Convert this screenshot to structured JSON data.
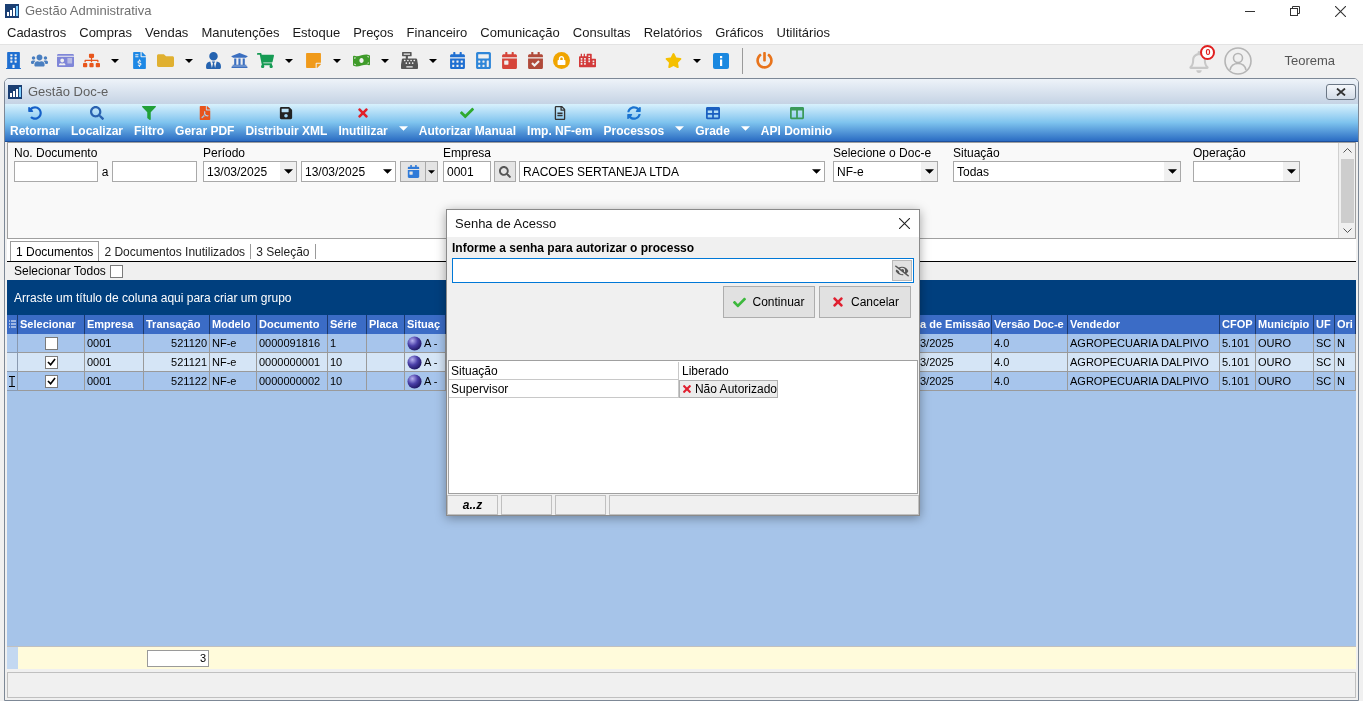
{
  "window": {
    "title": "Gestão Administrativa"
  },
  "menu": [
    "Cadastros",
    "Compras",
    "Vendas",
    "Manutenções",
    "Estoque",
    "Preços",
    "Financeiro",
    "Comunicação",
    "Consultas",
    "Relatórios",
    "Gráficos",
    "Utilitários"
  ],
  "toolbar": [
    {
      "kind": "button"
    },
    {
      "kind": "button"
    },
    {
      "kind": "button"
    },
    {
      "kind": "split"
    },
    {
      "kind": "button"
    },
    {
      "kind": "split"
    },
    {
      "kind": "button"
    },
    {
      "kind": "button"
    },
    {
      "kind": "split"
    },
    {
      "kind": "split"
    },
    {
      "kind": "split"
    },
    {
      "kind": "split"
    },
    {
      "kind": "button"
    },
    {
      "kind": "button"
    },
    {
      "kind": "button"
    },
    {
      "kind": "button"
    },
    {
      "kind": "button"
    },
    {
      "kind": "button"
    },
    {
      "kind": "split"
    },
    {
      "kind": "button"
    },
    {
      "kind": "separator"
    },
    {
      "kind": "button"
    }
  ],
  "notifications": {
    "count": "0"
  },
  "user": {
    "name": "Teorema"
  },
  "child_window": {
    "title": "Gestão Doc-e"
  },
  "ribbon": [
    {
      "label": "Retornar",
      "kind": "button"
    },
    {
      "label": "Localizar",
      "kind": "button"
    },
    {
      "label": "Filtro",
      "kind": "button"
    },
    {
      "label": "Gerar PDF",
      "kind": "button"
    },
    {
      "label": "Distribuir XML",
      "kind": "button"
    },
    {
      "label": "Inutilizar",
      "kind": "split"
    },
    {
      "label": "Autorizar Manual",
      "kind": "button"
    },
    {
      "label": "Imp. NF-em",
      "kind": "button"
    },
    {
      "label": "Processos",
      "kind": "split"
    },
    {
      "label": "Grade",
      "kind": "split"
    },
    {
      "label": "API Dominio",
      "kind": "button"
    }
  ],
  "filters": [
    {
      "kind": "range",
      "label": "No. Documento",
      "separator": "a"
    },
    {
      "kind": "date_range",
      "label": "Período",
      "from": "13/03/2025",
      "to": "13/03/2025"
    },
    {
      "kind": "lookup",
      "label": "Empresa",
      "code": "0001",
      "value": "RACOES SERTANEJA LTDA"
    },
    {
      "kind": "select",
      "label": "Selecione o Doc-e",
      "value": "NF-e"
    },
    {
      "kind": "select",
      "label": "Situação",
      "value": "Todas"
    },
    {
      "kind": "select",
      "label": "Operação"
    }
  ],
  "tabs": [
    {
      "label": "1 Documentos",
      "selected": true
    },
    {
      "label": "2 Documentos Inutilizados",
      "selected": false
    },
    {
      "label": "3 Seleção",
      "selected": false
    }
  ],
  "select_all": {
    "label": "Selecionar Todos",
    "checked": false
  },
  "group_panel": {
    "hint": "Arraste um título de coluna aqui para criar um grupo"
  },
  "grid": {
    "check_column": "Selecionar",
    "columns": [
      "Empresa",
      "Transação",
      "Modelo",
      "Documento",
      "Série",
      "Placa",
      "Situaç",
      "a de Emissão",
      "Versão Doc-e",
      "Vendedor",
      "CFOP",
      "Município",
      "UF",
      "Ori"
    ],
    "rows": [
      {
        "checked": false,
        "current": false,
        "cells": [
          "0001",
          "521120",
          "NF-e",
          "0000091816",
          "1",
          "",
          "A -",
          "3/2025",
          "4.0",
          "AGROPECUARIA DALPIVO",
          "5.101",
          "OURO",
          "SC",
          "N"
        ]
      },
      {
        "checked": true,
        "current": false,
        "cells": [
          "0001",
          "521121",
          "NF-e",
          "0000000001",
          "10",
          "",
          "A -",
          "3/2025",
          "4.0",
          "AGROPECUARIA DALPIVO",
          "5.101",
          "OURO",
          "SC",
          "N"
        ]
      },
      {
        "checked": true,
        "current": true,
        "cells": [
          "0001",
          "521122",
          "NF-e",
          "0000000002",
          "10",
          "",
          "A -",
          "3/2025",
          "4.0",
          "AGROPECUARIA DALPIVO",
          "5.101",
          "OURO",
          "SC",
          "N"
        ]
      }
    ],
    "footer": {
      "count": "3"
    }
  },
  "dialog": {
    "title": "Senha de Acesso",
    "prompt": "Informe a senha para autorizar o processo",
    "buttons": [
      {
        "label": "Continuar",
        "kind": "ok"
      },
      {
        "label": "Cancelar",
        "kind": "cancel"
      }
    ],
    "properties": [
      {
        "name": "Situação",
        "value": "Liberado",
        "kind": "text"
      },
      {
        "name": "Supervisor",
        "value": "Não Autorizado",
        "kind": "denied"
      }
    ],
    "status_bar": [
      "a..z"
    ]
  }
}
